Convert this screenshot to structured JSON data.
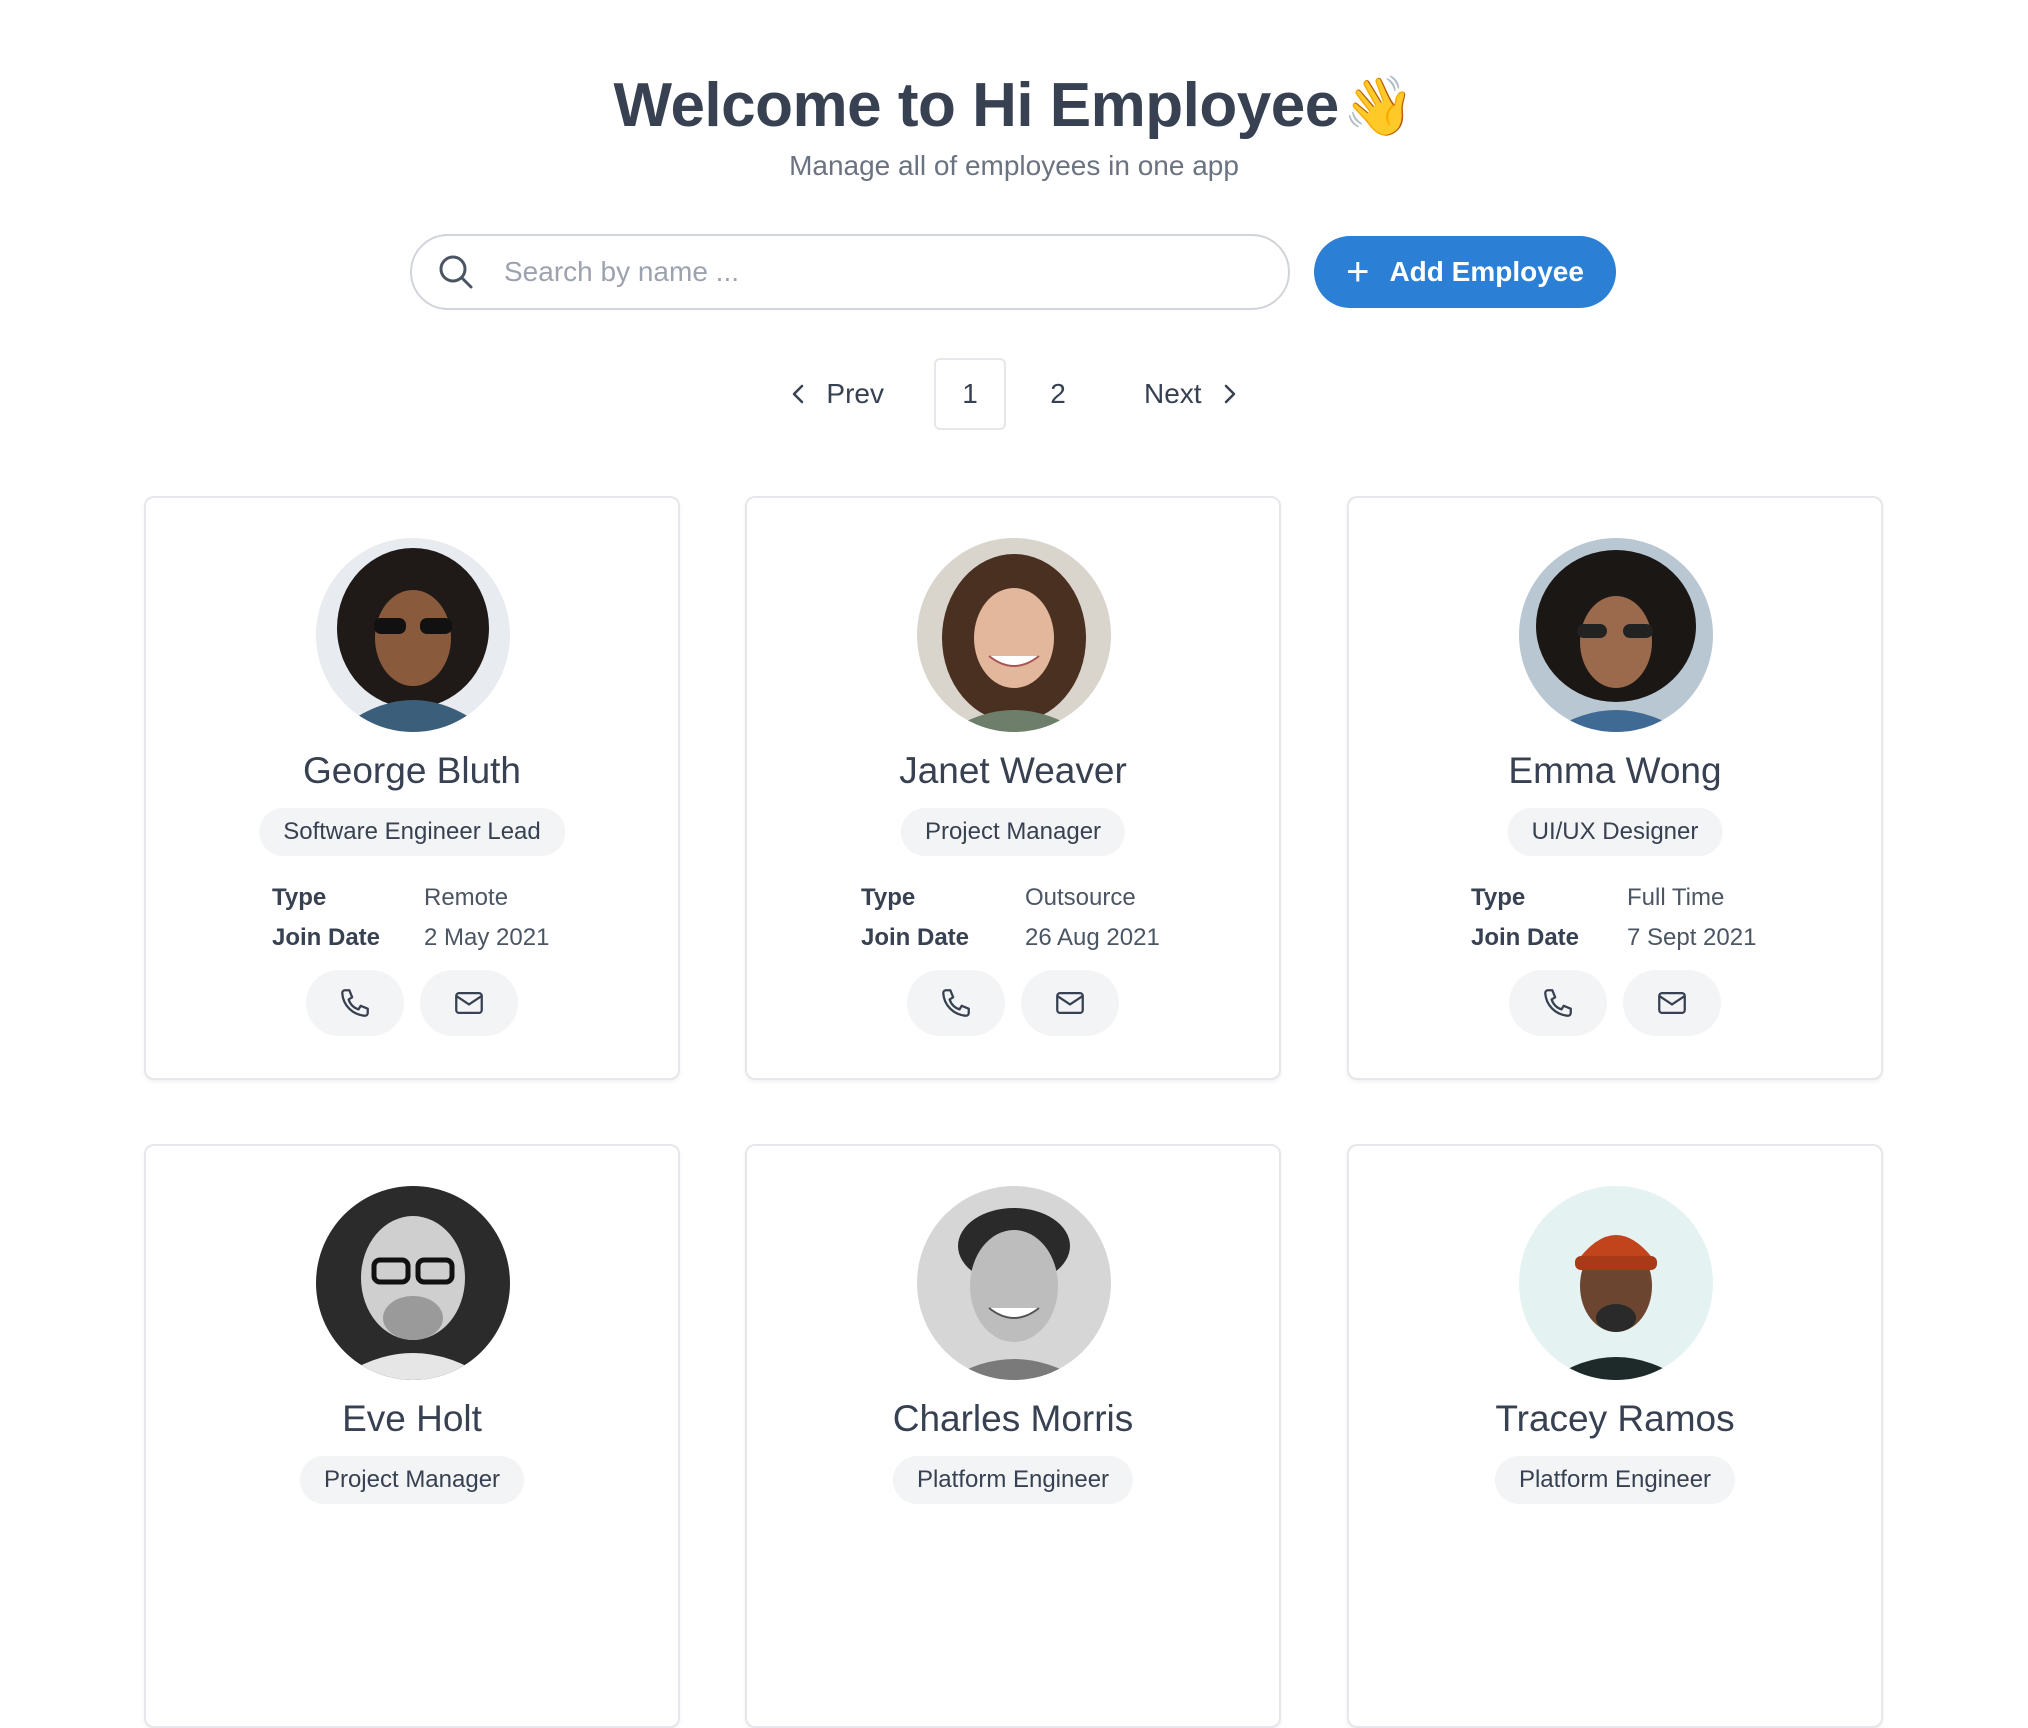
{
  "header": {
    "title": "Welcome to Hi Employee",
    "emoji": "👋",
    "subtitle": "Manage all of employees in one app"
  },
  "search": {
    "placeholder": "Search by name ...",
    "value": ""
  },
  "add_button": {
    "label": "Add Employee",
    "color": "#2b7fd4"
  },
  "pagination": {
    "prev_label": "Prev",
    "next_label": "Next",
    "pages": [
      "1",
      "2"
    ],
    "current": "1"
  },
  "labels": {
    "type": "Type",
    "join_date": "Join Date"
  },
  "employees": [
    {
      "name": "George Bluth",
      "role": "Software Engineer Lead",
      "type": "Remote",
      "join_date": "2 May 2021"
    },
    {
      "name": "Janet Weaver",
      "role": "Project Manager",
      "type": "Outsource",
      "join_date": "26 Aug 2021"
    },
    {
      "name": "Emma Wong",
      "role": "UI/UX Designer",
      "type": "Full Time",
      "join_date": "7 Sept 2021"
    },
    {
      "name": "Eve Holt",
      "role": "Project Manager"
    },
    {
      "name": "Charles Morris",
      "role": "Platform Engineer"
    },
    {
      "name": "Tracey Ramos",
      "role": "Platform Engineer"
    }
  ]
}
